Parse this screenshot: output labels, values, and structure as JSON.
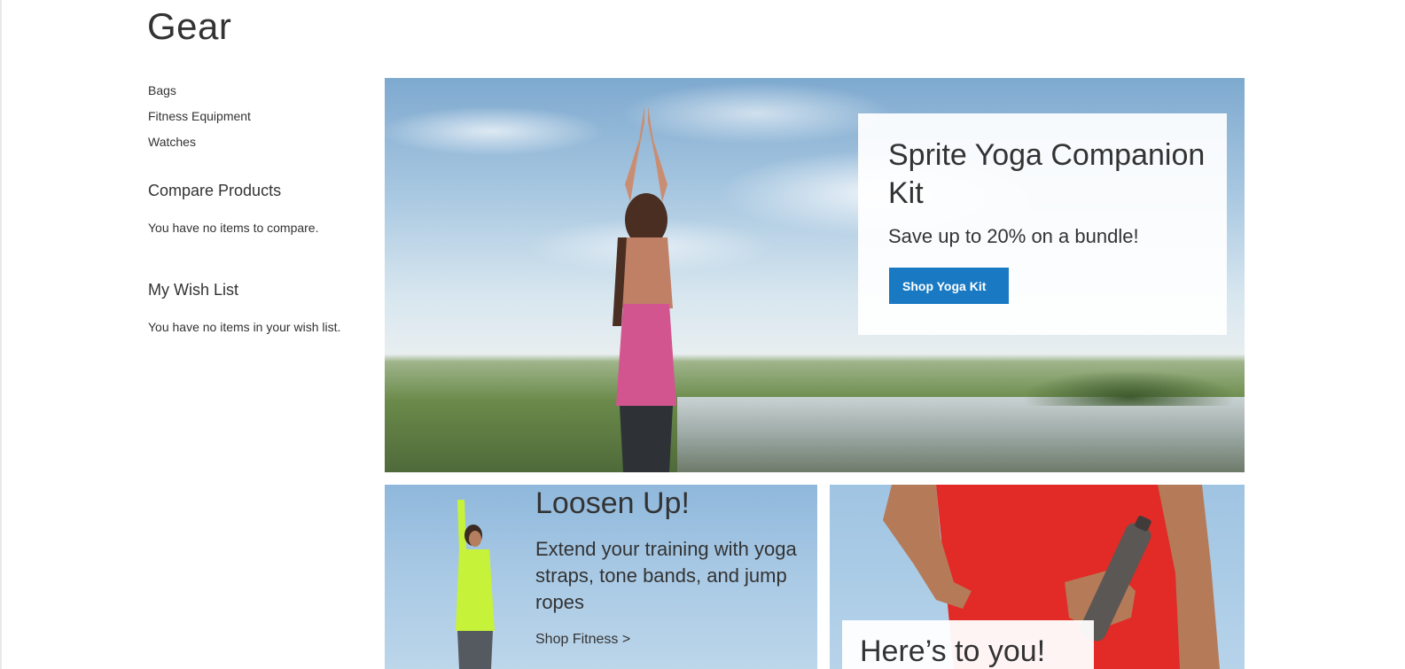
{
  "page": {
    "title": "Gear"
  },
  "sidebar": {
    "categories": [
      {
        "label": "Bags"
      },
      {
        "label": "Fitness Equipment"
      },
      {
        "label": "Watches"
      }
    ],
    "compare": {
      "title": "Compare Products",
      "empty": "You have no items to compare."
    },
    "wishlist": {
      "title": "My Wish List",
      "empty": "You have no items in your wish list."
    }
  },
  "hero": {
    "title": "Sprite Yoga Companion Kit",
    "subtitle": "Save up to 20% on a bundle!",
    "button": "Shop Yoga Kit"
  },
  "tile_left": {
    "title": "Loosen Up!",
    "text": "Extend your training with yoga straps, tone bands, and jump ropes",
    "link": "Shop Fitness >"
  },
  "tile_right": {
    "title": "Here’s to you!"
  },
  "colors": {
    "primary_button": "#1979c3",
    "text": "#333333"
  }
}
